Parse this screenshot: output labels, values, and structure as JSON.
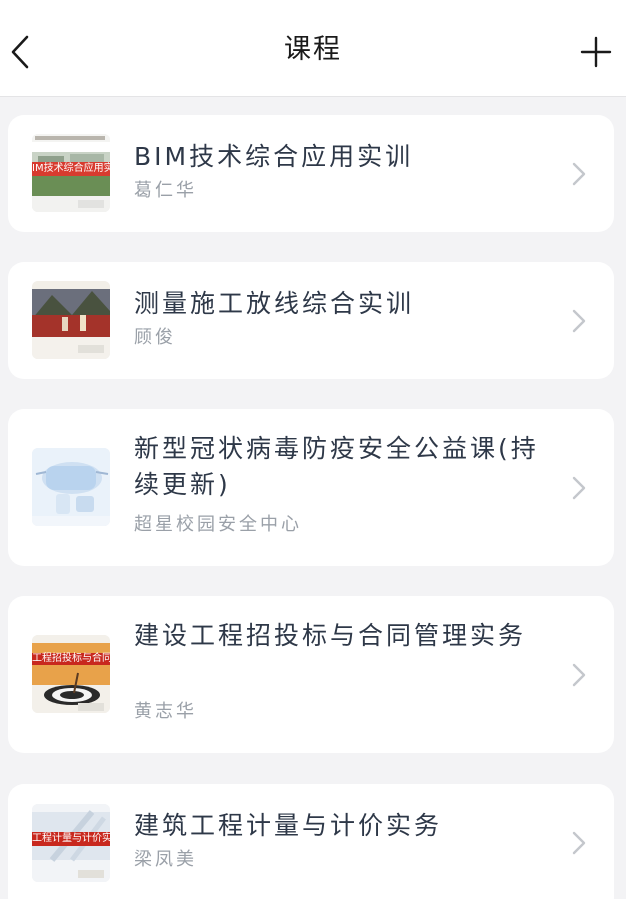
{
  "header": {
    "title": "课程"
  },
  "courses": [
    {
      "title": "BIM技术综合应用实训",
      "author": "葛仁华",
      "thumb_text": "IM技术综合应用实"
    },
    {
      "title": "测量施工放线综合实训",
      "author": "顾俊",
      "thumb_text": ""
    },
    {
      "title": "新型冠状病毒防疫安全公益课(持续更新)",
      "author": "超星校园安全中心",
      "thumb_text": ""
    },
    {
      "title": "建设工程招投标与合同管理实务",
      "author": "黄志华",
      "thumb_text": "工程招投标与合同管理"
    },
    {
      "title": "建筑工程计量与计价实务",
      "author": "梁凤美",
      "thumb_text": "工程计量与计价实"
    }
  ],
  "colors": {
    "brand_red": "#c8281e",
    "text": "#2e3848",
    "subtext": "#9aa0a8"
  },
  "icons": [
    "back-icon",
    "add-icon",
    "chevron-right-icon"
  ]
}
